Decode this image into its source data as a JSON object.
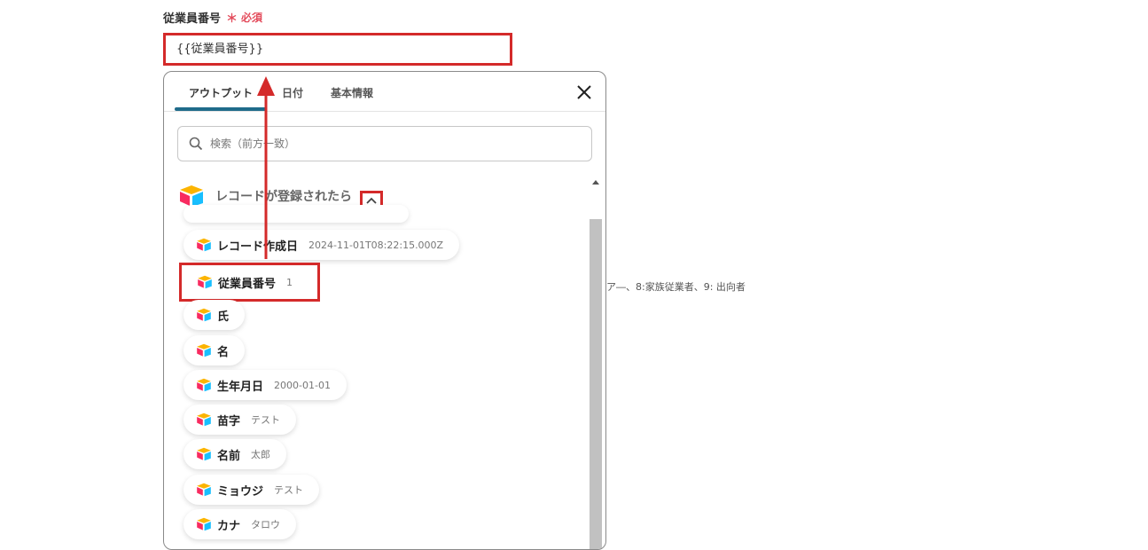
{
  "field": {
    "label": "従業員番号",
    "required_star": "＊",
    "required_text": "必須",
    "value": "{{従業員番号}}"
  },
  "background_note": "ア―、8:家族従業者、9: 出向者",
  "popup": {
    "tabs": [
      {
        "label": "アウトプット",
        "active": true
      },
      {
        "label": "日付",
        "active": false
      },
      {
        "label": "基本情報",
        "active": false
      }
    ],
    "search_placeholder": "検索（前方一致）",
    "section_title": "レコードが登録されたら",
    "items": [
      {
        "name": "レコード作成日",
        "value": "2024-11-01T08:22:15.000Z"
      },
      {
        "name": "従業員番号",
        "value": "1"
      },
      {
        "name": "氏",
        "value": ""
      },
      {
        "name": "名",
        "value": ""
      },
      {
        "name": "生年月日",
        "value": "2000-01-01"
      },
      {
        "name": "苗字",
        "value": "テスト"
      },
      {
        "name": "名前",
        "value": "太郎"
      },
      {
        "name": "ミョウジ",
        "value": "テスト"
      },
      {
        "name": "カナ",
        "value": "タロウ"
      }
    ]
  },
  "colors": {
    "highlight": "#d42a2a",
    "tab_active": "#1f6b8a",
    "required": "#e34b5b"
  },
  "icons": {
    "app": "airtable-icon",
    "close": "close-icon",
    "search": "search-icon",
    "collapse": "chevron-up-icon"
  }
}
